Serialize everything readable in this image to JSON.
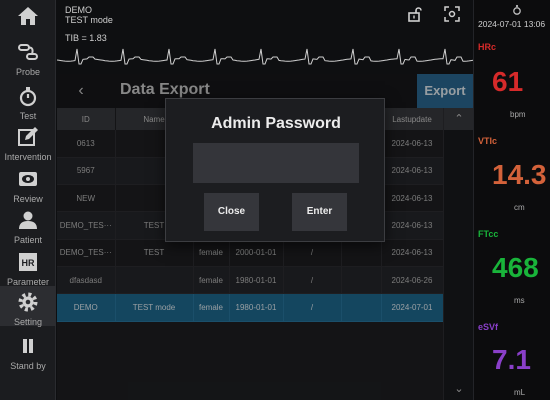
{
  "colors": {
    "accent": "#2b6b96",
    "selected_row": "#1f6c93",
    "hr": "#d62a2a",
    "vti": "#d4623a",
    "ftc": "#19b43a",
    "svi": "#8a3fc9"
  },
  "sidebar": {
    "items": [
      {
        "label": "",
        "icon": "home-icon"
      },
      {
        "label": "Probe",
        "icon": "probe-icon"
      },
      {
        "label": "Test",
        "icon": "stopwatch-icon"
      },
      {
        "label": "Intervention",
        "icon": "edit-icon"
      },
      {
        "label": "Review",
        "icon": "eye-icon"
      },
      {
        "label": "Patient",
        "icon": "person-icon"
      },
      {
        "label": "Parameter",
        "icon": "hr-icon",
        "badge": "HR"
      },
      {
        "label": "Setting",
        "icon": "gear-icon"
      },
      {
        "label": "Stand by",
        "icon": "pause-icon"
      }
    ]
  },
  "header": {
    "line1": "DEMO",
    "line2": "TEST mode",
    "datetime": "2024-07-01 13:06"
  },
  "ecg": {
    "label": "TIB = 1.83"
  },
  "panel": {
    "back_icon": "‹",
    "title": "Data Export",
    "export_label": "Export",
    "columns": [
      "ID",
      "Name",
      "",
      "",
      "",
      "",
      "Lastupdate"
    ],
    "rows": [
      {
        "cells": [
          "0613",
          "",
          "",
          "",
          "",
          "",
          "2024-06-13"
        ]
      },
      {
        "cells": [
          "5967",
          "",
          "",
          "",
          "",
          "",
          "2024-06-13"
        ]
      },
      {
        "cells": [
          "NEW",
          "",
          "",
          "",
          "",
          "",
          "2024-06-13"
        ]
      },
      {
        "cells": [
          "DEMO_TES···",
          "TEST",
          "",
          "",
          "",
          "",
          "2024-06-13"
        ]
      },
      {
        "cells": [
          "DEMO_TES···",
          "TEST",
          "female",
          "2000-01-01",
          "/",
          "",
          "2024-06-13"
        ]
      },
      {
        "cells": [
          "dfasdasd",
          "",
          "female",
          "1980-01-01",
          "/",
          "",
          "2024-06-26"
        ]
      },
      {
        "cells": [
          "DEMO",
          "TEST mode",
          "female",
          "1980-01-01",
          "/",
          "",
          "2024-07-01"
        ],
        "selected": true
      }
    ],
    "scroll_up": "⌃",
    "scroll_down": "⌄"
  },
  "modal": {
    "title": "Admin Password",
    "password_value": "",
    "close_label": "Close",
    "enter_label": "Enter"
  },
  "vitals": [
    {
      "label": "HRc",
      "value": "61",
      "unit": "bpm"
    },
    {
      "label": "VTIc",
      "value": "14.3",
      "unit": "cm"
    },
    {
      "label": "FTcc",
      "value": "468",
      "unit": "ms"
    },
    {
      "label": "eSVf",
      "value": "7.1",
      "unit": "mL"
    }
  ]
}
